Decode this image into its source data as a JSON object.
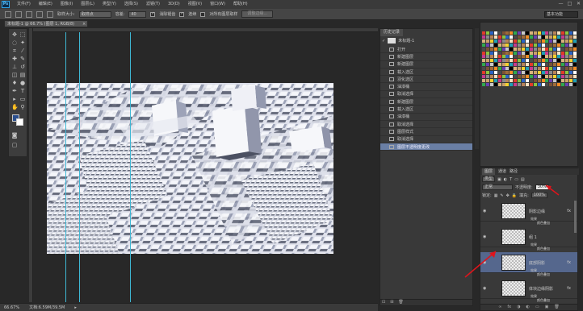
{
  "app": {
    "logo": "Ps"
  },
  "menu": [
    "文件(F)",
    "编辑(E)",
    "图像(I)",
    "图层(L)",
    "类型(Y)",
    "选择(S)",
    "滤镜(T)",
    "3D(D)",
    "视图(V)",
    "窗口(W)",
    "帮助(H)"
  ],
  "window_controls": [
    "—",
    "□",
    "✕"
  ],
  "options": {
    "sample_size_label": "取样大小:",
    "sample_size_value": "取样点",
    "tolerance_label": "容差:",
    "tolerance_value": "40",
    "antialias_label": "消除锯齿",
    "contiguous_label": "连续",
    "all_layers_label": "对所有图层取样",
    "refine_edge_button": "调整边缘...",
    "workspace": "基本功能"
  },
  "document": {
    "tab_title": "未标题-1 @ 66.7% (图层 1, RGB/8)",
    "close": "×",
    "zoom": "66.67%",
    "doc_info": "文档:6.59M/39.5M"
  },
  "history": {
    "tab_label": "历史记录",
    "source": "未标题-1",
    "items": [
      "打开",
      "新建图层",
      "新建图层",
      "载入选区",
      "羽化选区",
      "油漆桶",
      "取消选择",
      "新建图层",
      "载入选区",
      "油漆桶",
      "取消选择",
      "图层样式",
      "取消选择",
      "图层不透明度更改"
    ],
    "active_index": 13,
    "bottom_icons": [
      "⊡",
      "⊞",
      "🗑"
    ]
  },
  "layers": {
    "tabs": [
      "图层",
      "通道",
      "路径"
    ],
    "active_tab": 0,
    "kind_filter": "类型",
    "blend_mode": "正常",
    "opacity_label": "不透明度:",
    "opacity_value": "30%",
    "lock_label": "锁定:",
    "fill_label": "填充:",
    "fill_value": "100%",
    "list": [
      {
        "name": "阴影边缘",
        "fx": "fx",
        "effects_label": "效果",
        "effect": "颜色叠加",
        "selected": false
      },
      {
        "name": "组 1",
        "fx": "",
        "effects_label": "效果",
        "effect": "颜色叠加",
        "selected": false
      },
      {
        "name": "底部阴影",
        "fx": "fx",
        "effects_label": "效果",
        "effect": "颜色叠加",
        "selected": true
      },
      {
        "name": "体块边缘阴影",
        "fx": "fx",
        "effects_label": "效果",
        "effect": "颜色叠加",
        "selected": false
      }
    ],
    "bottom_icons": [
      "∞",
      "fx",
      "◑",
      "◐",
      "▭",
      "▣",
      "🗑"
    ]
  },
  "colors": {
    "guide": "#3fb7d4",
    "selected_layer": "#55678d",
    "history_active": "#6a7fa5",
    "annotation_red": "#e0141b",
    "foreground": "#2b4f8e",
    "background": "#ffffff"
  }
}
